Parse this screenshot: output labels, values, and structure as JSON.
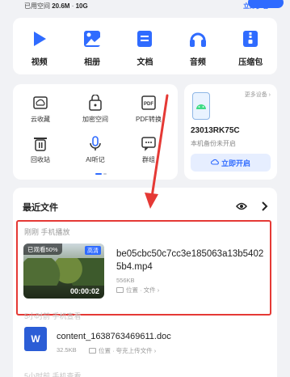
{
  "storage": {
    "used_label": "已用空间",
    "used_value": "20.6M",
    "separator": "·",
    "total_value": "10G",
    "upgrade_label": "立即扩容"
  },
  "tools": [
    {
      "label": "视频",
      "icon": "play-icon"
    },
    {
      "label": "相册",
      "icon": "photo-icon"
    },
    {
      "label": "文档",
      "icon": "document-icon"
    },
    {
      "label": "音频",
      "icon": "headphones-icon"
    },
    {
      "label": "压缩包",
      "icon": "zip-icon"
    }
  ],
  "services": [
    {
      "label": "云收藏",
      "icon": "cloud-favorite-icon"
    },
    {
      "label": "加密空间",
      "icon": "lock-bag-icon"
    },
    {
      "label": "PDF转换",
      "icon": "pdf-icon"
    },
    {
      "label": "回收站",
      "icon": "trash-icon"
    },
    {
      "label": "AI听记",
      "icon": "ai-listen-icon"
    },
    {
      "label": "群组",
      "icon": "group-chat-icon"
    }
  ],
  "device": {
    "more_label": "更多设备 ›",
    "name": "23013RK75C",
    "status": "本机备份未开启",
    "button_label": "立即开启"
  },
  "recent": {
    "title": "最近文件",
    "group1_label": "刚刚  手机播放",
    "video": {
      "watched_badge": "已观看50%",
      "hd_badge": "高清",
      "duration": "00:00:02",
      "name": "be05cbc50c7cc3e185063a13b54025b4.mp4",
      "size": "556KB",
      "location": "位置 · 文件 ›"
    },
    "group2_label": "5小时前  手机查看",
    "doc": {
      "name": "content_1638763469611.doc",
      "size": "32.5KB",
      "location": "位置 · 夸克上传文件 ›"
    },
    "group3_label": "5小时前  手机查看"
  },
  "colors": {
    "accent": "#2f6bff",
    "highlight": "#e53935",
    "word_blue": "#2b5dd6"
  }
}
